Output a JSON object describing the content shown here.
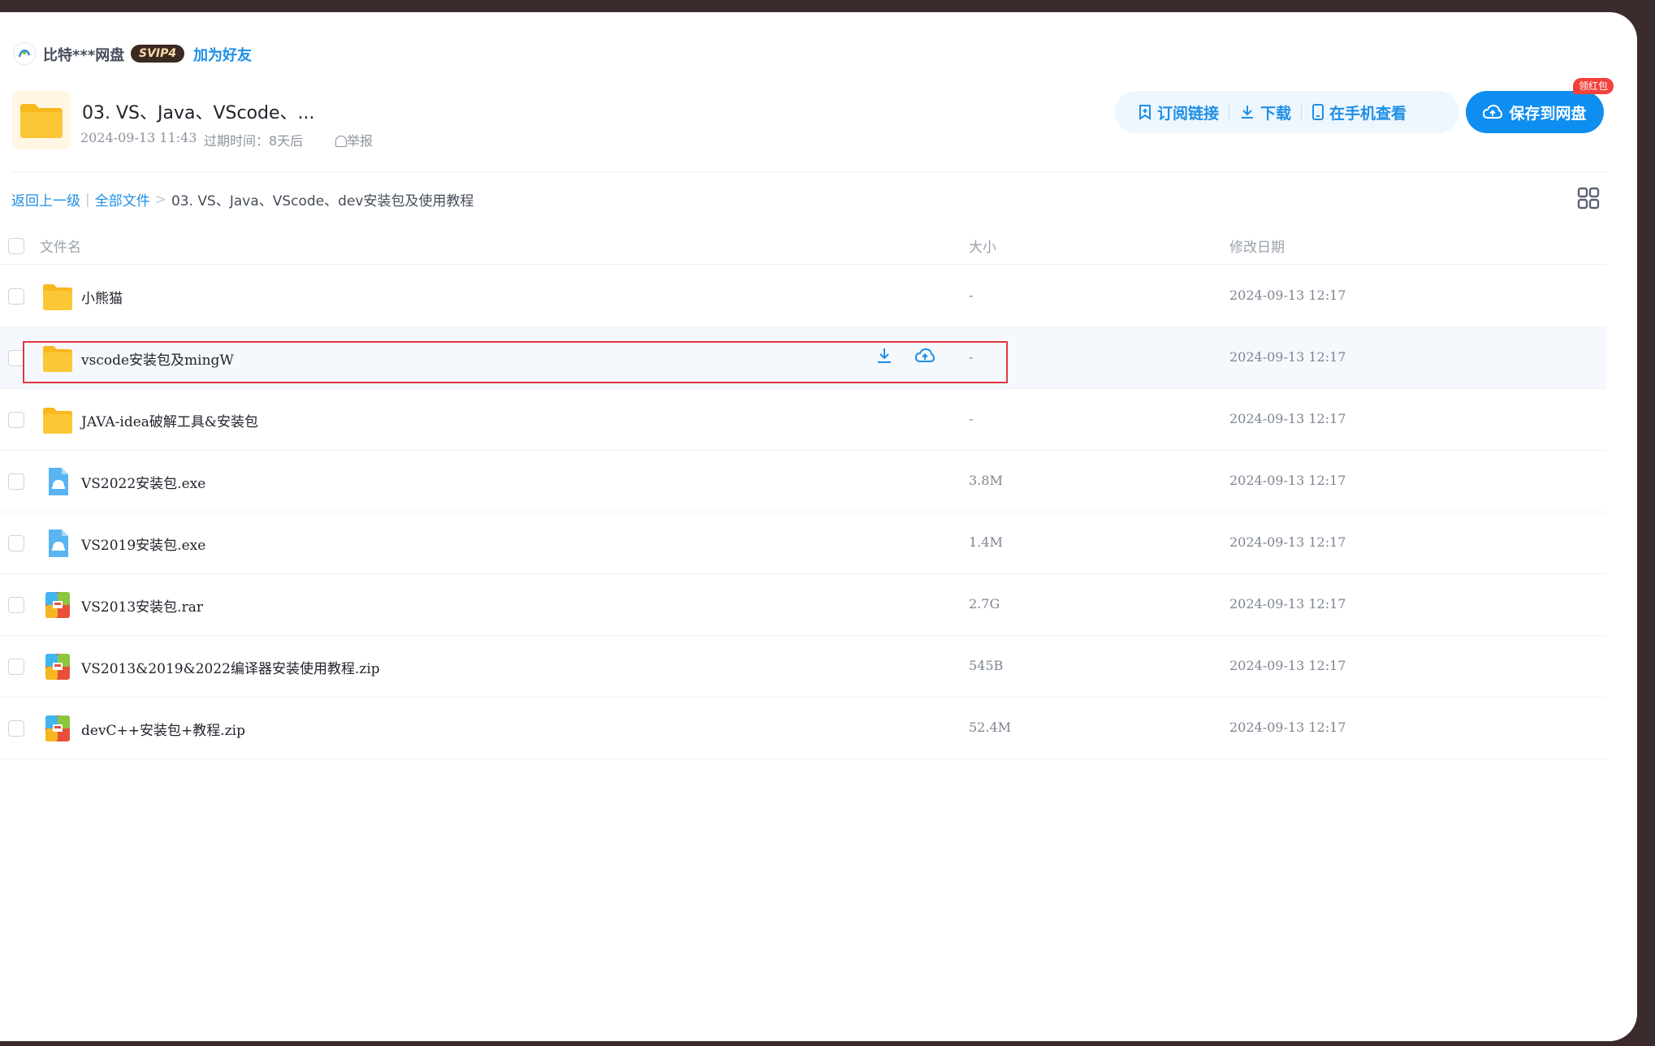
{
  "user": {
    "name": "比特***网盘",
    "vip": "SVIP4",
    "add_friend": "加为好友"
  },
  "share": {
    "title": "03. VS、Java、VScode、...",
    "date": "2024-09-13 11:43",
    "expiry": "过期时间：8天后",
    "report": "举报"
  },
  "actions": {
    "subscribe": "订阅链接",
    "download": "下载",
    "view_on_phone": "在手机查看",
    "save": "保存到网盘",
    "red_packet_badge": "领红包"
  },
  "breadcrumb": {
    "back": "返回上一级",
    "all_files": "全部文件",
    "separator": ">",
    "current": "03. VS、Java、VScode、dev安装包及使用教程",
    "pipe": "|"
  },
  "table": {
    "headers": {
      "name": "文件名",
      "size": "大小",
      "date": "修改日期"
    },
    "rows": [
      {
        "name": "小熊猫",
        "size": "-",
        "date": "2024-09-13 12:17",
        "icon": "folder-icon"
      },
      {
        "name": "vscode安装包及mingW",
        "size": "-",
        "date": "2024-09-13 12:17",
        "icon": "folder-icon"
      },
      {
        "name": "JAVA-idea破解工具&安装包",
        "size": "-",
        "date": "2024-09-13 12:17",
        "icon": "folder-icon"
      },
      {
        "name": "VS2022安装包.exe",
        "size": "3.8M",
        "date": "2024-09-13 12:17",
        "icon": "exe-file-icon"
      },
      {
        "name": "VS2019安装包.exe",
        "size": "1.4M",
        "date": "2024-09-13 12:17",
        "icon": "exe-file-icon"
      },
      {
        "name": "VS2013安装包.rar",
        "size": "2.7G",
        "date": "2024-09-13 12:17",
        "icon": "archive-file-icon"
      },
      {
        "name": "VS2013&2019&2022编译器安装使用教程.zip",
        "size": "545B",
        "date": "2024-09-13 12:17",
        "icon": "archive-file-icon"
      },
      {
        "name": "devC++安装包+教程.zip",
        "size": "52.4M",
        "date": "2024-09-13 12:17",
        "icon": "archive-file-icon"
      }
    ]
  },
  "colors": {
    "accent": "#1f8fe6",
    "highlight": "#e0393e",
    "folder": "#fcc736"
  }
}
